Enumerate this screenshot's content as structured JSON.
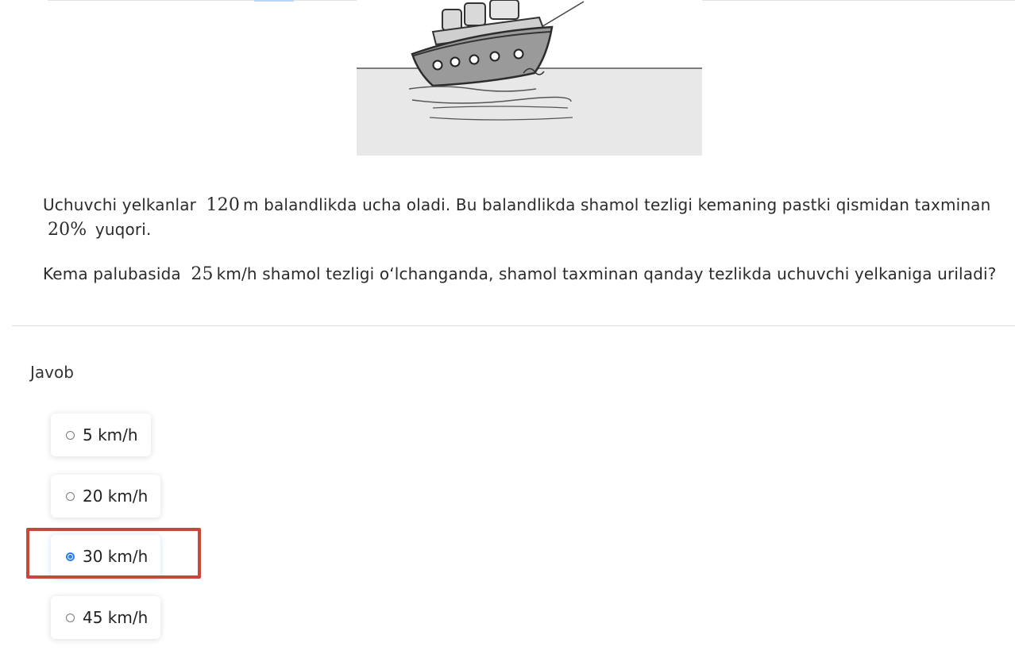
{
  "question": {
    "para1_prefix": "Uchuvchi yelkanlar",
    "para1_height": "120",
    "para1_mid": "m balandlikda ucha oladi. Bu balandlikda shamol tezligi kemaning pastki qismidan taxminan",
    "para1_percent": "20%",
    "para1_suffix": "yuqori.",
    "para2_prefix": "Kema palubasida",
    "para2_speed": "25",
    "para2_suffix": "km/h shamol tezligi o‘lchanganda, shamol taxminan qanday tezlikda uchuvchi yelkaniga uriladi?"
  },
  "answer": {
    "label": "Javob",
    "options": [
      {
        "label": "5 km/h",
        "selected": false
      },
      {
        "label": "20 km/h",
        "selected": false
      },
      {
        "label": "30 km/h",
        "selected": true
      },
      {
        "label": "45 km/h",
        "selected": false
      }
    ]
  },
  "colors": {
    "selected_radio": "#2f7fe8",
    "highlight_box": "#c9473a"
  }
}
